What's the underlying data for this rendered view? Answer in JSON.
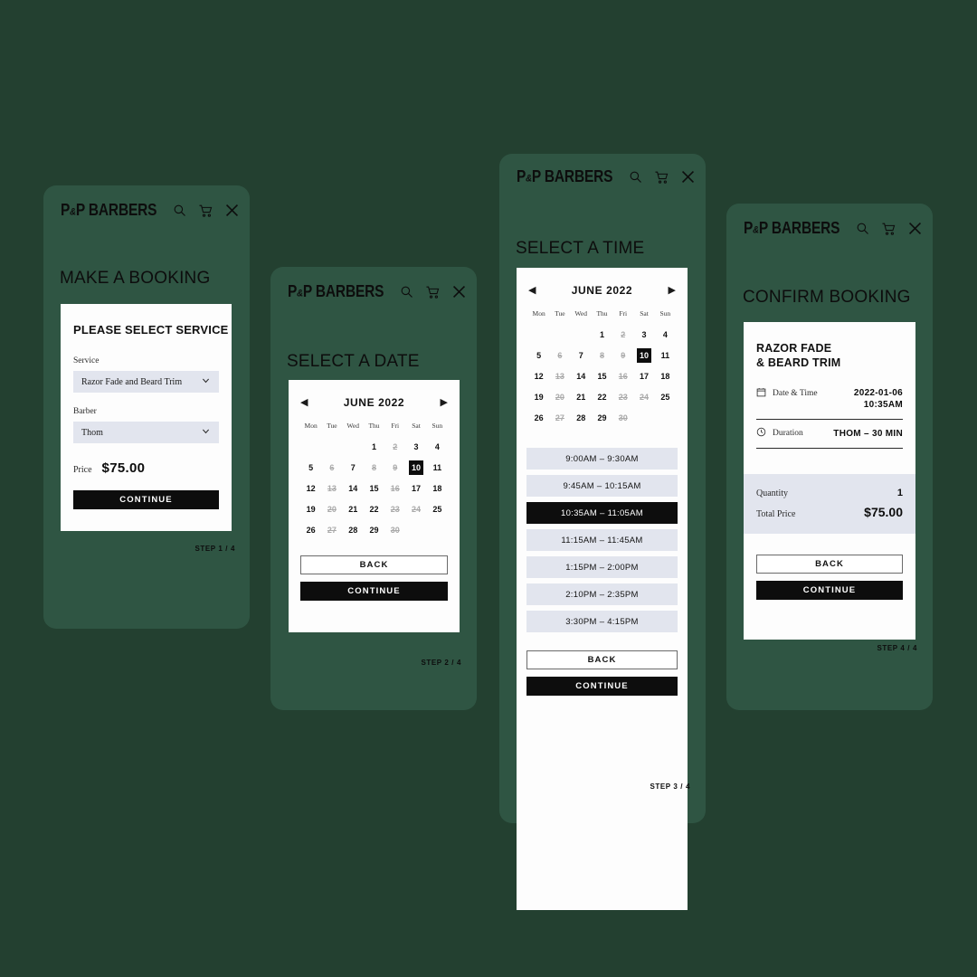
{
  "theme": {
    "background": "#234030",
    "panel": "#2f5543",
    "card": "#fdfdfd",
    "field": "#e2e5ee",
    "accent_dark": "#0d0d0d",
    "text_light": "#ffffff"
  },
  "brand": {
    "name_left": "P",
    "name_amp": "&",
    "name_right": "P BARBERS",
    "icons": [
      "search-icon",
      "cart-icon",
      "close-icon"
    ]
  },
  "screens": [
    {
      "id": "step1",
      "page_title": "MAKE A BOOKING",
      "card_title": "PLEASE SELECT SERVICE",
      "fields": [
        {
          "label": "Service",
          "value": "Razor Fade and Beard Trim"
        },
        {
          "label": "Barber",
          "value": "Thom"
        }
      ],
      "price_label": "Price",
      "price_value": "$75.00",
      "continue_label": "CONTINUE",
      "step_label": "STEP 1 / 4"
    },
    {
      "id": "step2",
      "page_title": "SELECT A DATE",
      "back_label": "BACK",
      "continue_label": "CONTINUE",
      "step_label": "STEP 2 / 4"
    },
    {
      "id": "step3",
      "page_title": "SELECT A TIME",
      "back_label": "BACK",
      "continue_label": "CONTINUE",
      "step_label": "STEP 3 / 4"
    },
    {
      "id": "step4",
      "page_title": "CONFIRM BOOKING",
      "service_title_line1": "RAZOR FADE",
      "service_title_line2": "& BEARD TRIM",
      "details": [
        {
          "icon": "calendar-icon",
          "label": "Date & Time",
          "value_line1": "2022-01-06",
          "value_line2": "10:35AM"
        },
        {
          "icon": "clock-icon",
          "label": "Duration",
          "value_line1": "THOM – 30 MIN",
          "value_line2": ""
        }
      ],
      "totals": [
        {
          "label": "Quantity",
          "value": "1"
        },
        {
          "label": "Total Price",
          "value": "$75.00"
        }
      ],
      "back_label": "BACK",
      "continue_label": "CONTINUE",
      "step_label": "STEP 4 / 4"
    }
  ],
  "calendar": {
    "month": "JUNE 2022",
    "prev_icon": "chevron-left-icon",
    "next_icon": "chevron-right-icon",
    "weekdays": [
      "Mon",
      "Tue",
      "Wed",
      "Thu",
      "Fri",
      "Sat",
      "Sun"
    ],
    "lead_blanks": 3,
    "days": [
      {
        "n": "1",
        "state": "on"
      },
      {
        "n": "2",
        "state": "off"
      },
      {
        "n": "3",
        "state": "on"
      },
      {
        "n": "4",
        "state": "on"
      },
      {
        "n": "5",
        "state": "on"
      },
      {
        "n": "6",
        "state": "off"
      },
      {
        "n": "7",
        "state": "on"
      },
      {
        "n": "8",
        "state": "off"
      },
      {
        "n": "9",
        "state": "off"
      },
      {
        "n": "10",
        "state": "selected"
      },
      {
        "n": "11",
        "state": "on"
      },
      {
        "n": "12",
        "state": "on"
      },
      {
        "n": "13",
        "state": "off"
      },
      {
        "n": "14",
        "state": "on"
      },
      {
        "n": "15",
        "state": "on"
      },
      {
        "n": "16",
        "state": "off"
      },
      {
        "n": "17",
        "state": "on"
      },
      {
        "n": "18",
        "state": "on"
      },
      {
        "n": "19",
        "state": "on"
      },
      {
        "n": "20",
        "state": "off"
      },
      {
        "n": "21",
        "state": "on"
      },
      {
        "n": "22",
        "state": "on"
      },
      {
        "n": "23",
        "state": "off"
      },
      {
        "n": "24",
        "state": "off"
      },
      {
        "n": "25",
        "state": "on"
      },
      {
        "n": "26",
        "state": "on"
      },
      {
        "n": "27",
        "state": "off"
      },
      {
        "n": "28",
        "state": "on"
      },
      {
        "n": "29",
        "state": "on"
      },
      {
        "n": "30",
        "state": "off"
      }
    ]
  },
  "time_slots": [
    {
      "label": "9:00AM – 9:30AM",
      "state": "on"
    },
    {
      "label": "9:45AM – 10:15AM",
      "state": "on"
    },
    {
      "label": "10:35AM – 11:05AM",
      "state": "selected"
    },
    {
      "label": "11:15AM – 11:45AM",
      "state": "on"
    },
    {
      "label": "1:15PM – 2:00PM",
      "state": "on"
    },
    {
      "label": "2:10PM – 2:35PM",
      "state": "on"
    },
    {
      "label": "3:30PM – 4:15PM",
      "state": "on"
    }
  ]
}
